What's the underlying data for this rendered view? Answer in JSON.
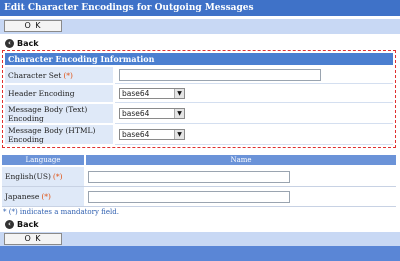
{
  "page": {
    "title": "Edit Character Encodings for Outgoing Messages",
    "ok_label": "O K",
    "back_label": "Back"
  },
  "encoding_section": {
    "header": "Character Encoding Information",
    "required_marker": "(*)",
    "rows": [
      {
        "label": "Character Set",
        "required": true,
        "type": "text",
        "value": ""
      },
      {
        "label": "Header Encoding",
        "required": false,
        "type": "select",
        "value": "base64"
      },
      {
        "label": "Message Body (Text) Encoding",
        "required": false,
        "type": "select",
        "value": "base64"
      },
      {
        "label": "Message Body (HTML) Encoding",
        "required": false,
        "type": "select",
        "value": "base64"
      }
    ]
  },
  "language_table": {
    "columns": [
      "Language",
      "Name"
    ],
    "rows": [
      {
        "language": "English(US)",
        "required": true,
        "name": ""
      },
      {
        "language": "Japanese",
        "required": true,
        "name": ""
      }
    ]
  },
  "note": "* (*) indicates a mandatory field."
}
